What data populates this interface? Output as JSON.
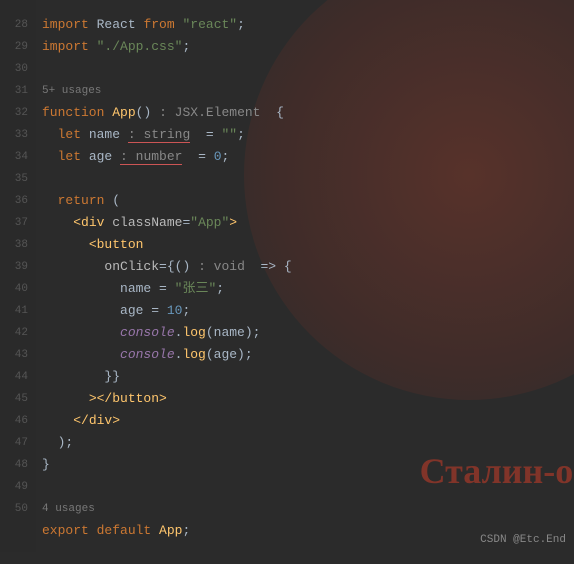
{
  "lineNumbers": [
    "28",
    "29",
    "30",
    "",
    "31",
    "32",
    "33",
    "34",
    "35",
    "36",
    "37",
    "38",
    "39",
    "40",
    "41",
    "42",
    "43",
    "44",
    "45",
    "46",
    "47",
    "48",
    "",
    "49",
    "50"
  ],
  "hints": {
    "usagesTop": "5+ usages",
    "usagesBottom": "4 usages"
  },
  "code": {
    "import1": {
      "kw": "import",
      "ident": "React",
      "from": "from",
      "str": "\"react\"",
      "semi": ";"
    },
    "import2": {
      "kw": "import",
      "str": "\"./App.css\"",
      "semi": ";"
    },
    "fn": {
      "kw": "function",
      "name": "App",
      "parens": "()",
      "type": ": JSX.Element",
      "brace": "  {"
    },
    "let1": {
      "kw": "let",
      "ident": "name",
      "type": ": string",
      "eq": "  =",
      "str": "\"\"",
      "semi": ";"
    },
    "let2": {
      "kw": "let",
      "ident": "age",
      "type": ": number",
      "eq": "  =",
      "val": "0",
      "semi": ";"
    },
    "return": {
      "kw": "return",
      "paren": "("
    },
    "div": {
      "open": "<div",
      "attr": "className",
      "eq": "=",
      "str": "\"App\"",
      "close": ">"
    },
    "button": {
      "open": "<button"
    },
    "onclick": {
      "attr": "onClick",
      "eq": "={",
      "parens": "()",
      "type": ": void",
      "arrow": "  => {"
    },
    "assign1": {
      "ident": "name",
      "eq": " = ",
      "str": "\"张三\"",
      "semi": ";"
    },
    "assign2": {
      "ident": "age",
      "eq": " = ",
      "val": "10",
      "semi": ";"
    },
    "log1": {
      "obj": "console",
      "dot": ".",
      "method": "log",
      "args": "(name);"
    },
    "log2": {
      "obj": "console",
      "dot": ".",
      "method": "log",
      "args": "(age);"
    },
    "onclickClose": "}}",
    "buttonClose": "></button>",
    "divClose": "</div>",
    "returnClose": ");",
    "fnClose": "}",
    "export": {
      "kw1": "export",
      "kw2": "default",
      "name": "App",
      "semi": ";"
    }
  },
  "watermark": "CSDN @Etc.End",
  "bgText": "Сталин-он"
}
